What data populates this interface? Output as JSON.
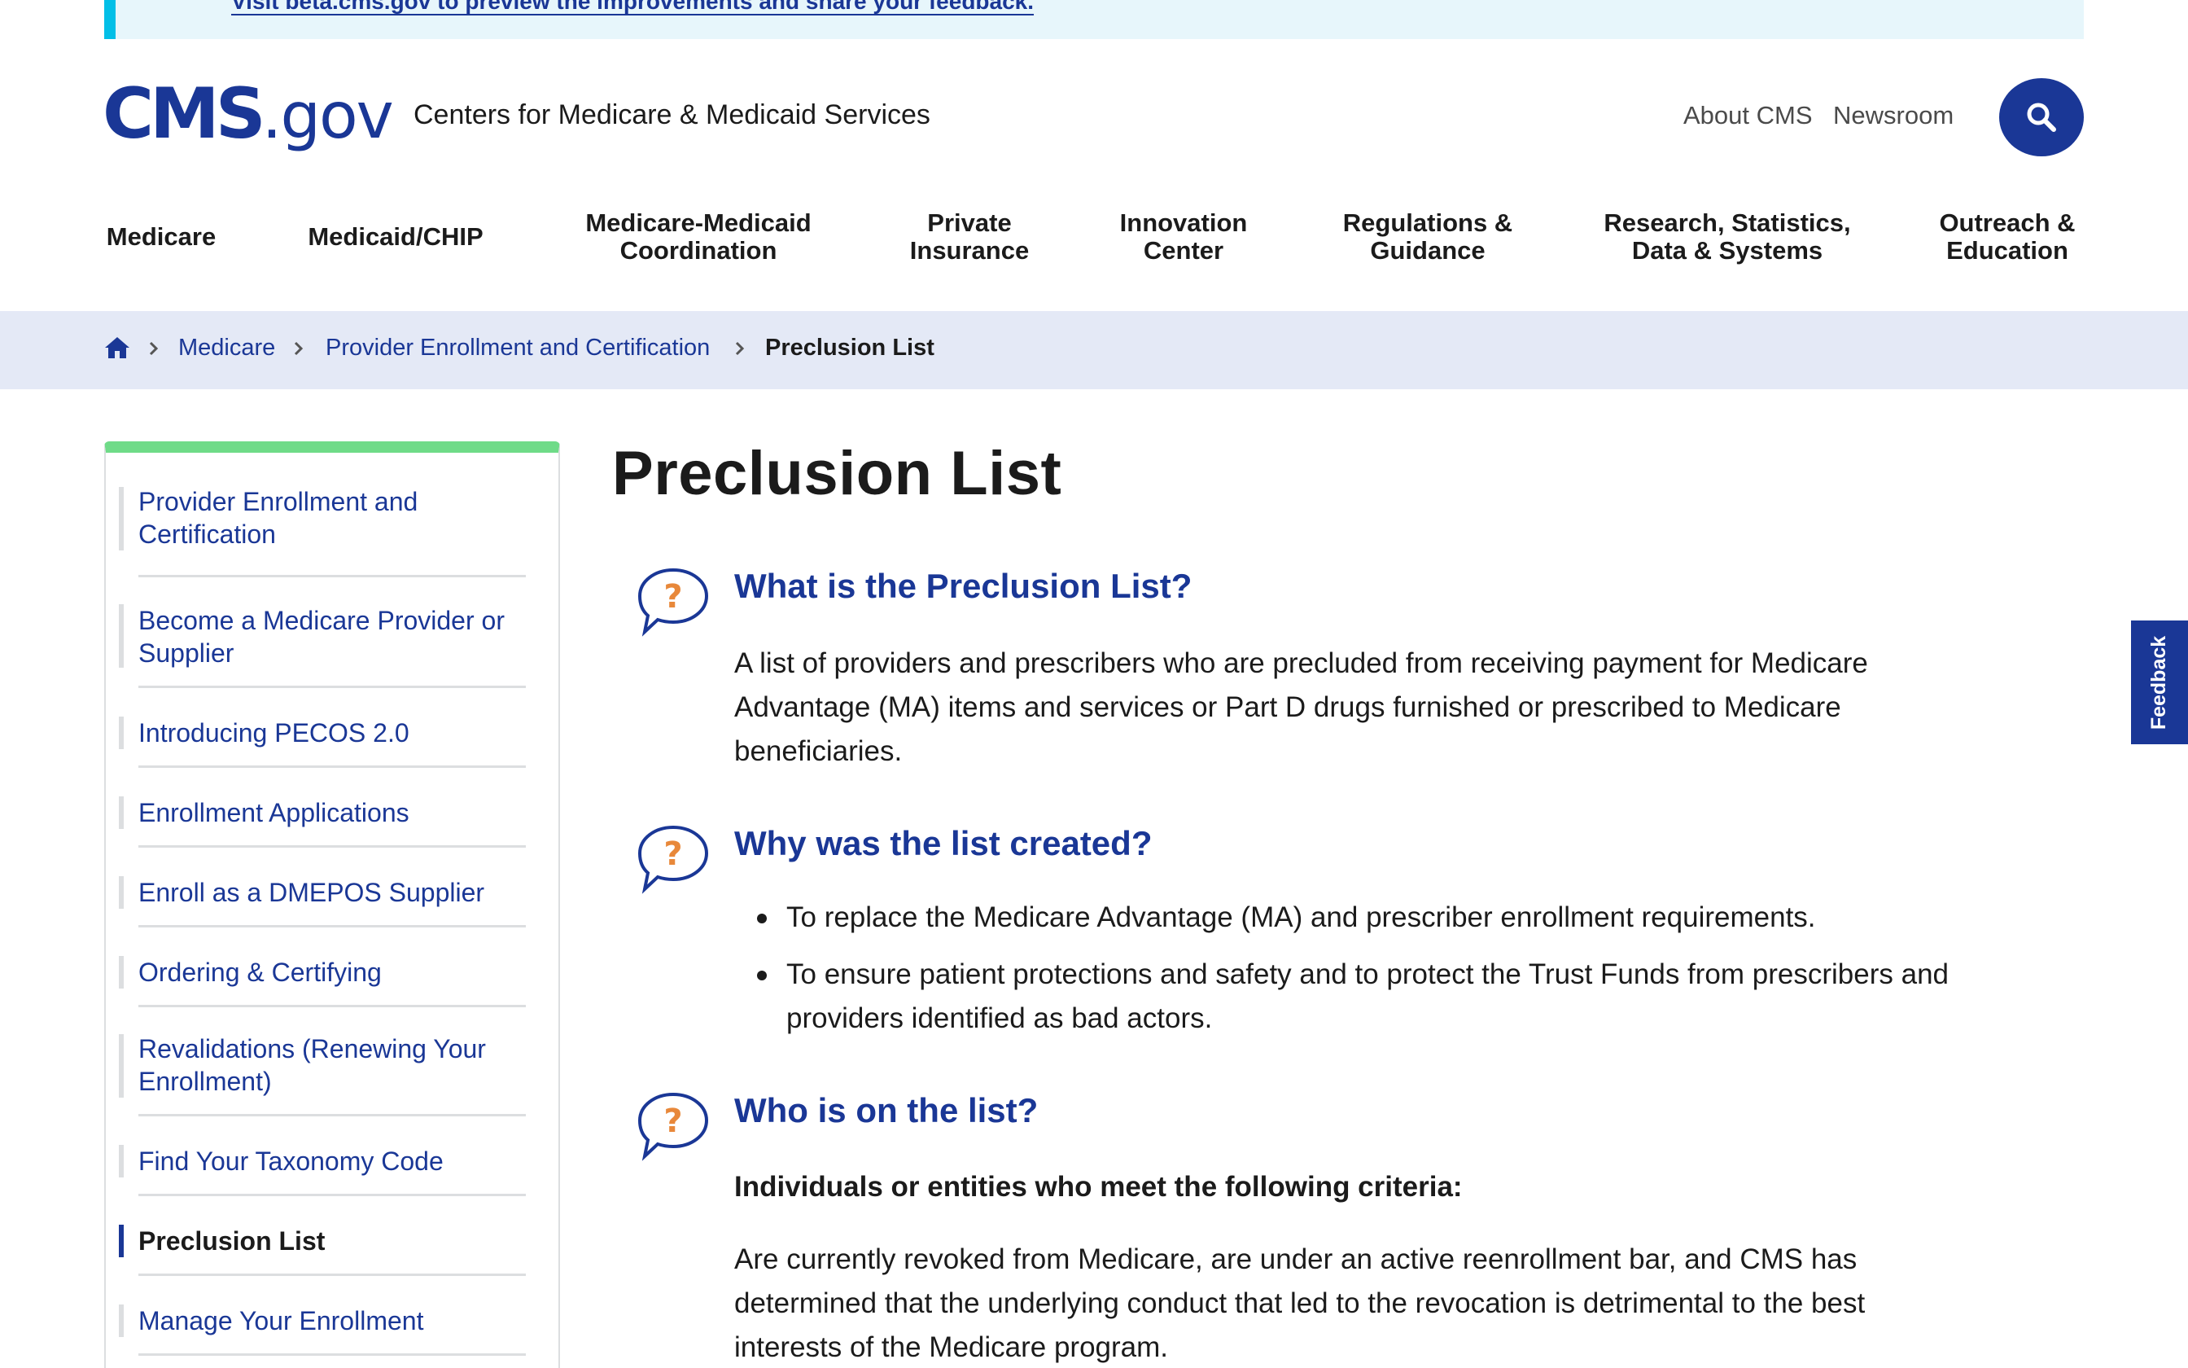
{
  "banner": {
    "link_text": "Visit beta.cms.gov to preview the improvements and share your feedback."
  },
  "header": {
    "logo_main": "CMS",
    "logo_dot": ".",
    "logo_suffix": "gov",
    "site_name": "Centers for Medicare & Medicaid Services",
    "utility_links": [
      "About CMS",
      "Newsroom"
    ],
    "search_icon": "search-icon"
  },
  "nav": {
    "items": [
      {
        "line1": "Medicare",
        "line2": ""
      },
      {
        "line1": "Medicaid/CHIP",
        "line2": ""
      },
      {
        "line1": "Medicare-Medicaid",
        "line2": "Coordination"
      },
      {
        "line1": "Private",
        "line2": "Insurance"
      },
      {
        "line1": "Innovation",
        "line2": "Center"
      },
      {
        "line1": "Regulations &",
        "line2": "Guidance"
      },
      {
        "line1": "Research, Statistics,",
        "line2": "Data & Systems"
      },
      {
        "line1": "Outreach &",
        "line2": "Education"
      }
    ]
  },
  "breadcrumb": {
    "home_icon": "home-icon",
    "items": [
      "Medicare",
      "Provider Enrollment and Certification",
      "Preclusion List"
    ]
  },
  "sidebar": {
    "items": [
      {
        "line1": "Provider Enrollment and",
        "line2": "Certification"
      },
      {
        "line1": "Become a Medicare Provider or",
        "line2": "Supplier"
      },
      {
        "line1": "Introducing PECOS 2.0",
        "line2": ""
      },
      {
        "line1": "Enrollment Applications",
        "line2": ""
      },
      {
        "line1": "Enroll as a DMEPOS Supplier",
        "line2": ""
      },
      {
        "line1": "Ordering & Certifying",
        "line2": ""
      },
      {
        "line1": "Revalidations (Renewing Your",
        "line2": "Enrollment)"
      },
      {
        "line1": "Find Your Taxonomy Code",
        "line2": ""
      },
      {
        "line1": "Preclusion List",
        "line2": ""
      },
      {
        "line1": "Manage Your Enrollment",
        "line2": ""
      }
    ],
    "current_index": 8
  },
  "main": {
    "title": "Preclusion List",
    "sections": [
      {
        "heading": "What is the Preclusion List?",
        "body_lines": [
          "A list of providers and prescribers who are precluded from receiving payment for Medicare",
          "Advantage (MA) items and services or Part D drugs furnished or prescribed to Medicare",
          "beneficiaries."
        ]
      },
      {
        "heading": "Why was the list created?",
        "bullets": [
          {
            "line1": "To replace the Medicare Advantage (MA) and prescriber enrollment requirements.",
            "line2": ""
          },
          {
            "line1": "To ensure patient protections and safety and to protect the Trust Funds from prescribers and",
            "line2": "providers identified as bad actors."
          }
        ]
      },
      {
        "heading": "Who is on the list?",
        "strong": "Individuals or entities who meet the following criteria:",
        "body_lines": [
          "Are currently revoked from Medicare, are under an active reenrollment bar, and CMS has",
          "determined that the underlying conduct that led to the revocation is detrimental to the best",
          "interests of the Medicare program."
        ]
      }
    ],
    "question_icon": "question-bubble-icon"
  },
  "feedback": {
    "label": "Feedback"
  },
  "colors": {
    "brand_blue": "#1a3796",
    "accent_green": "#6fdb88",
    "question_orange": "#e8883a",
    "breadcrumb_bg": "#e4e9f6",
    "banner_bg": "#e7f6fb"
  }
}
